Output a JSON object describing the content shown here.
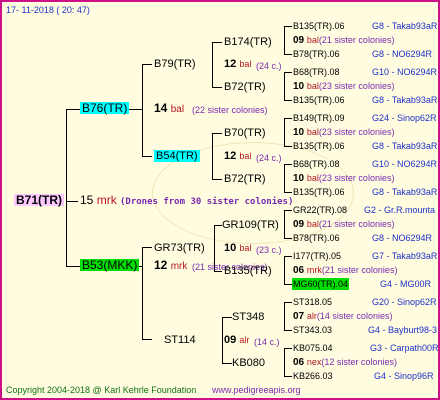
{
  "header": {
    "date": "17- 11-2018 ( 20: 47)"
  },
  "footer": {
    "copyright": "Copyright 2004-2018 @ Karl Kehrle Foundation",
    "site": "www.pedigreeapis.org"
  },
  "root": {
    "id": "B71(TR)",
    "num": "15",
    "tag": "mrk",
    "note": "(Drones from 30 sister colonies)"
  },
  "gen1": [
    {
      "id": "B76(TR)",
      "num": "14",
      "tag": "bal",
      "note": "(22 sister colonies)"
    },
    {
      "id": "B53(MKK)",
      "num": "12",
      "tag": "mrk",
      "note": "(21 sister colonies)"
    }
  ],
  "gen2": [
    {
      "id": "B79(TR)",
      "num": "12",
      "tag": "bal",
      "note": "(24 c.)"
    },
    {
      "id": "B54(TR)",
      "num": "12",
      "tag": "bal",
      "note": "(24 c.)"
    },
    {
      "id": "GR73(TR)",
      "num": "10",
      "tag": "bal",
      "note": "(23 c.)"
    },
    {
      "id": "ST114",
      "num": "09",
      "tag": "alr",
      "note": "(14 c.)"
    }
  ],
  "gen3": [
    "B174(TR)",
    "B72(TR)",
    "B70(TR)",
    "B72(TR)",
    "GR109(TR)",
    "B135(TR)",
    "ST348",
    "KB080"
  ],
  "gen4": [
    {
      "top": "B135(TR).06",
      "topRight": "G8 - Takab93aR",
      "num": "09",
      "tag": "bal",
      "note": "(21 sister colonies)",
      "bot": "B78(TR).06",
      "botRight": "G8 - NO6294R"
    },
    {
      "top": "B68(TR).08",
      "topRight": "G10 - NO6294R",
      "num": "10",
      "tag": "bal",
      "note": "(23 sister colonies)",
      "bot": "B135(TR).06",
      "botRight": "G8 - Takab93aR"
    },
    {
      "top": "B149(TR).09",
      "topRight": "G24 - Sinop62R",
      "num": "10",
      "tag": "bal",
      "note": "(23 sister colonies)",
      "bot": "B135(TR).06",
      "botRight": "G8 - Takab93aR"
    },
    {
      "top": "B68(TR).08",
      "topRight": "G10 - NO6294R",
      "num": "10",
      "tag": "bal",
      "note": "(23 sister colonies)",
      "bot": "B135(TR).06",
      "botRight": "G8 - Takab93aR"
    },
    {
      "top": "GR22(TR).08",
      "topRight": "G2 - Gr.R.mounta",
      "num": "09",
      "tag": "bal",
      "note": "(21 sister colonies)",
      "bot": "B78(TR).06",
      "botRight": "G8 - NO6294R"
    },
    {
      "top": "I177(TR).05",
      "topRight": "G7 - Takab93aR",
      "num": "06",
      "tag": "mrk",
      "note": "(21 sister colonies)",
      "bot": "MG60(TR).04",
      "botRight": "G4 - MG00R"
    },
    {
      "top": "ST318.05",
      "topRight": "G20 - Sinop62R",
      "num": "07",
      "tag": "alr",
      "note": "(14 sister colonies)",
      "bot": "ST343.03",
      "botRight": "G4 - Bayburt98-3"
    },
    {
      "top": "KB075.04",
      "topRight": "G3 - Carpath00R",
      "num": "06",
      "tag": "nex",
      "note": "(12 sister colonies)",
      "bot": "KB266.03",
      "botRight": "G4 - Sinop96R"
    }
  ],
  "colors": {
    "border": "#cc1188",
    "bg": "#fffce0",
    "cyan": "#00ffff",
    "green": "#00dd00",
    "pink": "#ffc8ff",
    "blue": "#1e30c8",
    "red": "#b4161e",
    "purple": "#7a2ab0"
  }
}
